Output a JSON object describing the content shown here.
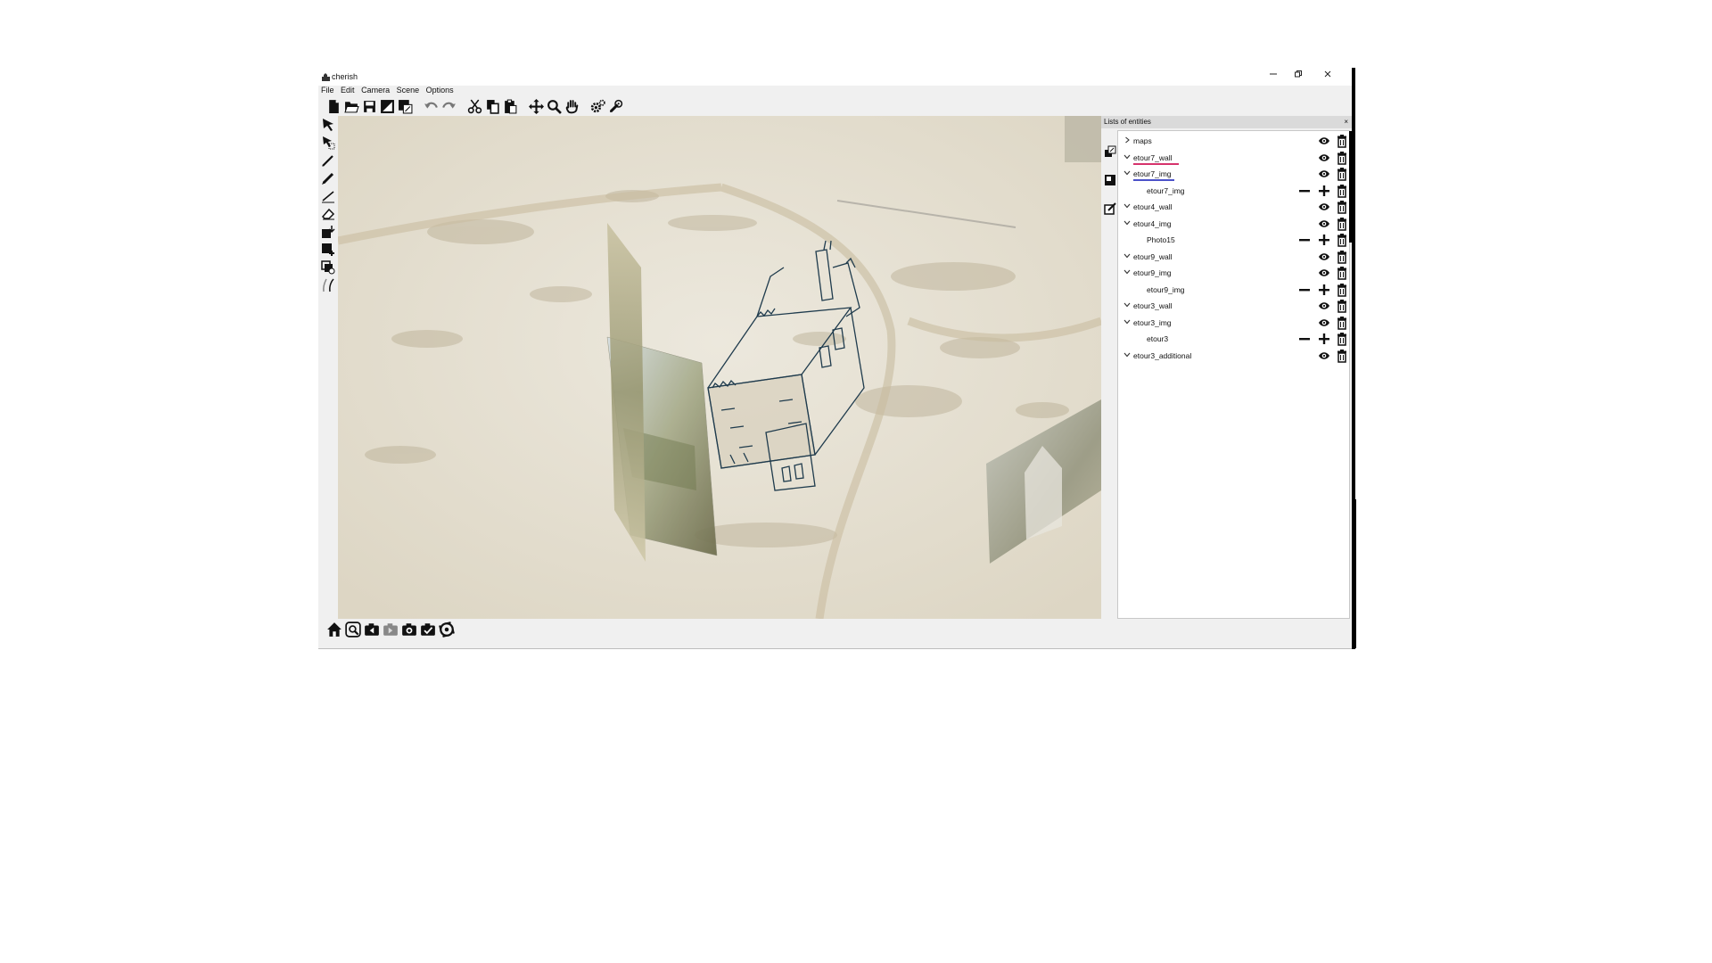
{
  "window": {
    "title": "cherish",
    "controls": [
      "minimize-icon",
      "restore-icon",
      "close-icon"
    ]
  },
  "menu": [
    "File",
    "Edit",
    "Camera",
    "Scene",
    "Options"
  ],
  "toolbar": [
    "new-file-icon",
    "open-folder-icon",
    "save-icon",
    "save-as-icon",
    "export-icon",
    "undo-icon",
    "redo-icon",
    "cut-icon",
    "copy-icon",
    "paste-icon",
    "move-icon",
    "zoom-icon",
    "pan-hand-icon",
    "settings-icon",
    "camera-settings-icon"
  ],
  "left_tools": [
    "select-arrow-icon",
    "select-multi-icon",
    "pen-icon",
    "pencil-icon",
    "line-icon",
    "eraser-icon",
    "import-image-icon",
    "add-image-icon",
    "add-layer-icon",
    "bezier-icon"
  ],
  "bottom_tools": [
    "home-icon",
    "camera-search-icon",
    "camera-prev-icon",
    "camera-disabled-icon",
    "camera-snap-icon",
    "camera-check-icon",
    "rotate-camera-icon"
  ],
  "side_icons": [
    "bring-front-icon",
    "new-entity-icon",
    "edit-entity-icon"
  ],
  "panel": {
    "title": "Lists of entities",
    "rows": [
      {
        "label": "maps",
        "level": 0,
        "expanded": false,
        "underline": "",
        "controls": [
          "eye",
          "trash"
        ]
      },
      {
        "label": "etour7_wall",
        "level": 0,
        "expanded": true,
        "underline": "#d6336c",
        "controls": [
          "eye",
          "trash"
        ]
      },
      {
        "label": "etour7_img",
        "level": 0,
        "expanded": true,
        "underline": "#4c52c9",
        "controls": [
          "eye",
          "trash"
        ]
      },
      {
        "label": "etour7_img",
        "level": 1,
        "expanded": null,
        "underline": "",
        "controls": [
          "minus",
          "plus",
          "trash"
        ]
      },
      {
        "label": "etour4_wall",
        "level": 0,
        "expanded": true,
        "underline": "",
        "controls": [
          "eye",
          "trash"
        ]
      },
      {
        "label": "etour4_img",
        "level": 0,
        "expanded": true,
        "underline": "",
        "controls": [
          "eye",
          "trash"
        ]
      },
      {
        "label": "Photo15",
        "level": 1,
        "expanded": null,
        "underline": "",
        "controls": [
          "minus",
          "plus",
          "trash"
        ]
      },
      {
        "label": "etour9_wall",
        "level": 0,
        "expanded": true,
        "underline": "",
        "controls": [
          "eye",
          "trash"
        ]
      },
      {
        "label": "etour9_img",
        "level": 0,
        "expanded": true,
        "underline": "",
        "controls": [
          "eye",
          "trash"
        ]
      },
      {
        "label": "etour9_img",
        "level": 1,
        "expanded": null,
        "underline": "",
        "controls": [
          "minus",
          "plus",
          "trash"
        ]
      },
      {
        "label": "etour3_wall",
        "level": 0,
        "expanded": true,
        "underline": "",
        "controls": [
          "eye",
          "trash"
        ]
      },
      {
        "label": "etour3_img",
        "level": 0,
        "expanded": true,
        "underline": "",
        "controls": [
          "eye",
          "trash"
        ]
      },
      {
        "label": "etour3",
        "level": 1,
        "expanded": null,
        "underline": "",
        "controls": [
          "minus",
          "plus",
          "trash"
        ]
      },
      {
        "label": "etour3_additional",
        "level": 0,
        "expanded": true,
        "underline": "",
        "controls": [
          "eye",
          "trash"
        ]
      }
    ]
  },
  "colors": {
    "accent_stroke": "#1f3b4d",
    "map_background": "#e9e4d7",
    "panel_header": "#dadada"
  }
}
